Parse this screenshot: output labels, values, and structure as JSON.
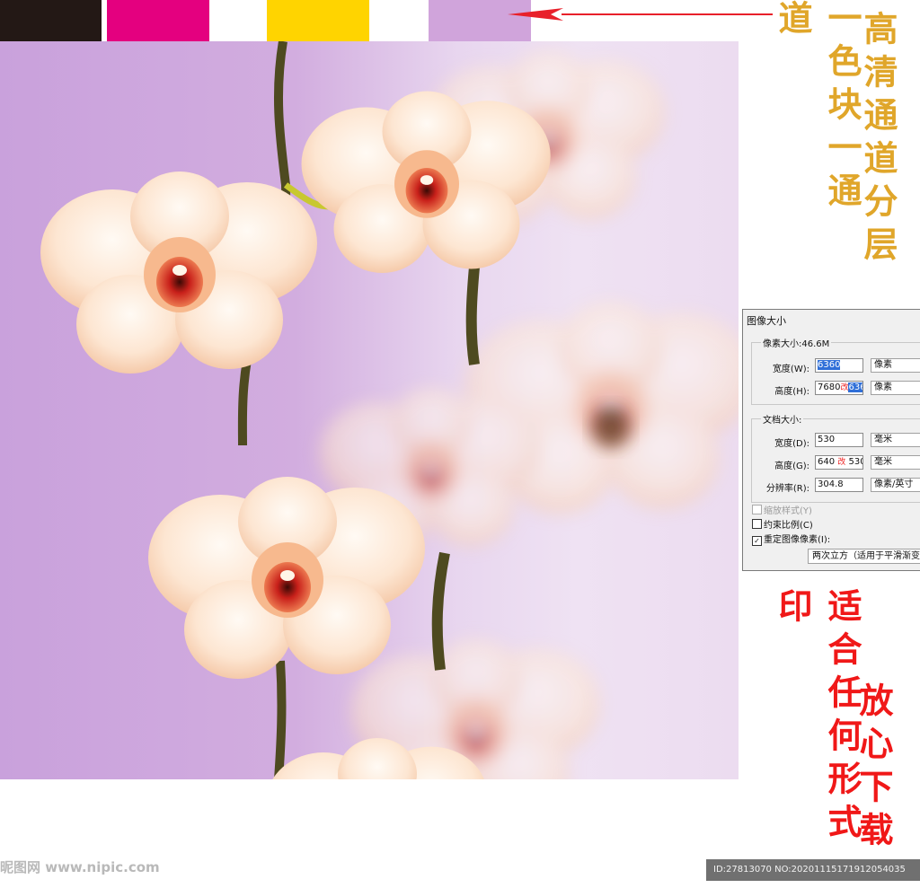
{
  "swatches": [
    {
      "name": "black",
      "color": "#231815"
    },
    {
      "name": "magenta",
      "color": "#e4007f"
    },
    {
      "name": "white",
      "color": "#ffffff"
    },
    {
      "name": "yellow",
      "color": "#ffd400"
    },
    {
      "name": "white",
      "color": "#ffffff"
    },
    {
      "name": "lilac",
      "color": "#d0a4db"
    }
  ],
  "colors": {
    "arrow": "#e8202a",
    "gold_text": "#e0a62a",
    "red_text": "#f01818",
    "background_lilac": "#c9a1dc"
  },
  "captions": {
    "color_block": "一色块一通道",
    "hd_channels": "高清通道分层",
    "suitable_print": "适合任何形式印",
    "download": "放心下载"
  },
  "dialog": {
    "title": "图像大小",
    "pixel_group_label": "像素大小:46.6M",
    "width_label": "宽度(W):",
    "width_value": "6360",
    "width_unit": "像素",
    "height_label": "高度(H):",
    "height_value_old": "7680",
    "height_change_mark": "改",
    "height_value_new": "6360",
    "height_unit": "像素",
    "doc_group_label": "文档大小:",
    "doc_width_label": "宽度(D):",
    "doc_width_value": "530",
    "doc_width_unit": "毫米",
    "doc_height_label": "高度(G):",
    "doc_height_value_old": "640",
    "doc_height_change_mark": "改",
    "doc_height_value_new": "530",
    "doc_height_unit": "毫米",
    "resolution_label": "分辨率(R):",
    "resolution_value": "304.8",
    "resolution_unit": "像素/英寸",
    "scale_styles": "缩放样式(Y)",
    "constrain": "约束比例(C)",
    "resample": "重定图像像素(I):",
    "resample_method": "两次立方（适用于平滑渐变"
  },
  "watermark": "昵图网 www.nipic.com",
  "id_text": "ID:27813070 NO:20201115171912054035"
}
